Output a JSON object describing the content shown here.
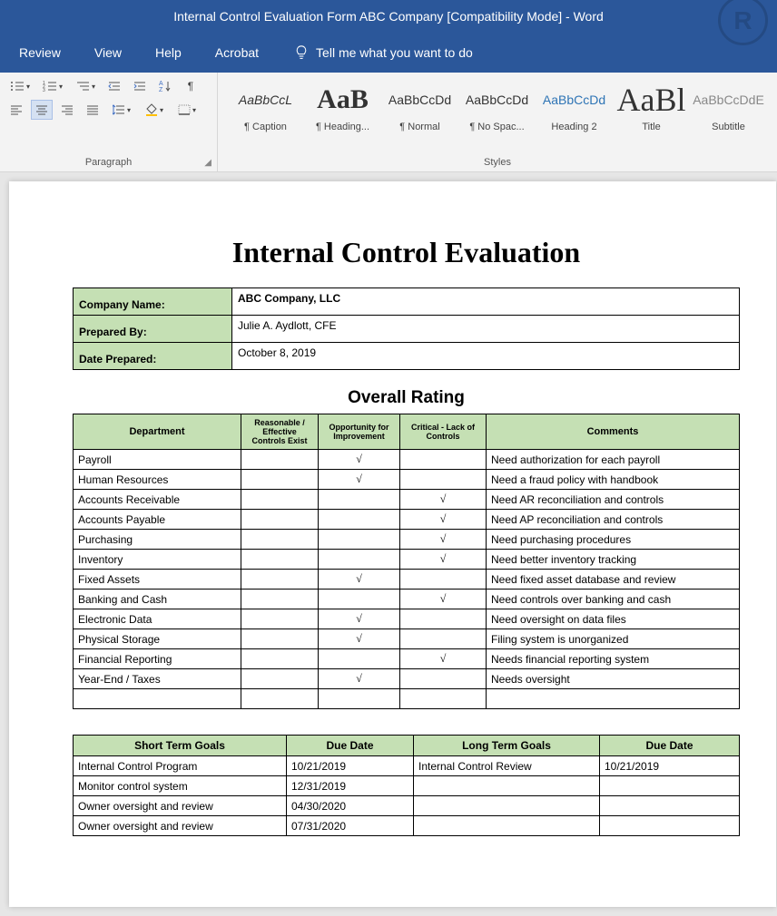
{
  "titlebar": "Internal Control Evaluation Form ABC Company [Compatibility Mode]  -  Word",
  "tabs": [
    "Review",
    "View",
    "Help",
    "Acrobat"
  ],
  "tell_me": "Tell me what you want to do",
  "ribbon": {
    "paragraph_label": "Paragraph",
    "styles_label": "Styles",
    "styles": [
      {
        "preview": "AaBbCcL",
        "name": "¶ Caption",
        "cls": "italic"
      },
      {
        "preview": "AaB",
        "name": "¶ Heading...",
        "cls": "big"
      },
      {
        "preview": "AaBbCcDd",
        "name": "¶ Normal",
        "cls": ""
      },
      {
        "preview": "AaBbCcDd",
        "name": "¶ No Spac...",
        "cls": ""
      },
      {
        "preview": "AaBbCcDd",
        "name": "Heading 2",
        "cls": "blue"
      },
      {
        "preview": "AaBl",
        "name": "Title",
        "cls": "biggest"
      },
      {
        "preview": "AaBbCcDdE",
        "name": "Subtitle",
        "cls": ""
      }
    ]
  },
  "doc": {
    "title": "Internal Control Evaluation",
    "info": {
      "company_label": "Company Name:",
      "company_value": "ABC Company, LLC",
      "prepared_by_label": "Prepared By:",
      "prepared_by_value": "Julie A. Aydlott, CFE",
      "date_label": "Date Prepared:",
      "date_value": "October 8, 2019"
    },
    "rating_heading": "Overall Rating",
    "rating_headers": {
      "dept": "Department",
      "reasonable": "Reasonable / Effective Controls Exist",
      "opportunity": "Opportunity for Improvement",
      "critical": "Critical - Lack of Controls",
      "comments": "Comments"
    },
    "rating_rows": [
      {
        "dept": "Payroll",
        "r": "",
        "o": "√",
        "c": "",
        "comment": "Need authorization for each payroll"
      },
      {
        "dept": "Human Resources",
        "r": "",
        "o": "√",
        "c": "",
        "comment": "Need a fraud policy with handbook"
      },
      {
        "dept": "Accounts Receivable",
        "r": "",
        "o": "",
        "c": "√",
        "comment": "Need AR reconciliation and controls"
      },
      {
        "dept": "Accounts Payable",
        "r": "",
        "o": "",
        "c": "√",
        "comment": "Need AP reconciliation and controls"
      },
      {
        "dept": "Purchasing",
        "r": "",
        "o": "",
        "c": "√",
        "comment": "Need purchasing procedures"
      },
      {
        "dept": "Inventory",
        "r": "",
        "o": "",
        "c": "√",
        "comment": "Need better inventory tracking"
      },
      {
        "dept": "Fixed Assets",
        "r": "",
        "o": "√",
        "c": "",
        "comment": "Need fixed asset database and review"
      },
      {
        "dept": "Banking and Cash",
        "r": "",
        "o": "",
        "c": "√",
        "comment": "Need controls over banking and cash"
      },
      {
        "dept": "Electronic Data",
        "r": "",
        "o": "√",
        "c": "",
        "comment": "Need oversight on data files"
      },
      {
        "dept": "Physical Storage",
        "r": "",
        "o": "√",
        "c": "",
        "comment": "Filing system is unorganized"
      },
      {
        "dept": "Financial Reporting",
        "r": "",
        "o": "",
        "c": "√",
        "comment": "Needs financial reporting system"
      },
      {
        "dept": "Year-End / Taxes",
        "r": "",
        "o": "√",
        "c": "",
        "comment": "Needs oversight"
      },
      {
        "dept": "",
        "r": "",
        "o": "",
        "c": "",
        "comment": ""
      }
    ],
    "goals_headers": {
      "short": "Short Term Goals",
      "due1": "Due Date",
      "long": "Long Term Goals",
      "due2": "Due Date"
    },
    "goals_rows": [
      {
        "s": "Internal Control Program",
        "d1": "10/21/2019",
        "l": "Internal Control Review",
        "d2": "10/21/2019"
      },
      {
        "s": "Monitor control system",
        "d1": "12/31/2019",
        "l": "",
        "d2": ""
      },
      {
        "s": "Owner oversight and review",
        "d1": "04/30/2020",
        "l": "",
        "d2": ""
      },
      {
        "s": "Owner oversight and review",
        "d1": "07/31/2020",
        "l": "",
        "d2": ""
      }
    ]
  }
}
